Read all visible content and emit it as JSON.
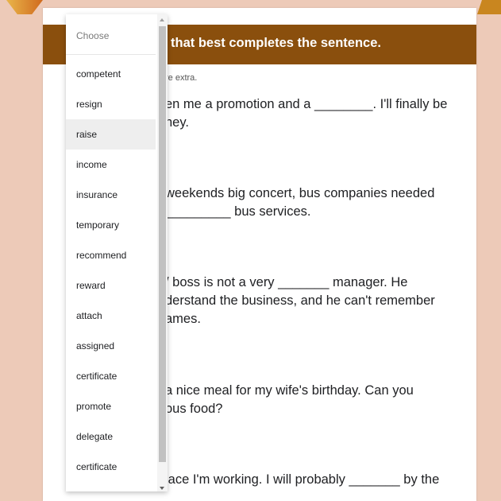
{
  "header": {
    "title": "that best completes the sentence."
  },
  "note": "re extra.",
  "questions": [
    {
      "line1": "en me a promotion and a ________. I'll finally be",
      "line2": "ney."
    },
    {
      "line1": "weekends big concert, bus companies needed",
      "line2": "_________ bus services."
    },
    {
      "line1": "/ boss is not a very _______ manager. He",
      "line2": "derstand the business, and he can't remember",
      "line3": "ames."
    },
    {
      "line1": "a nice meal for my wife's birthday. Can you",
      "line2": "ous food?"
    },
    {
      "line1": "lace I'm working. I will probably _______ by the"
    }
  ],
  "dropdown": {
    "placeholder": "Choose",
    "options": [
      "competent",
      "resign",
      "raise",
      "income",
      "insurance",
      "temporary",
      "recommend",
      "reward",
      "attach",
      "assigned",
      "certificate",
      "promote",
      "delegate",
      "certificate"
    ],
    "hovered_option": "raise"
  },
  "colors": {
    "header_bg": "#8a4f0d",
    "page_bg": "#edcab8"
  }
}
